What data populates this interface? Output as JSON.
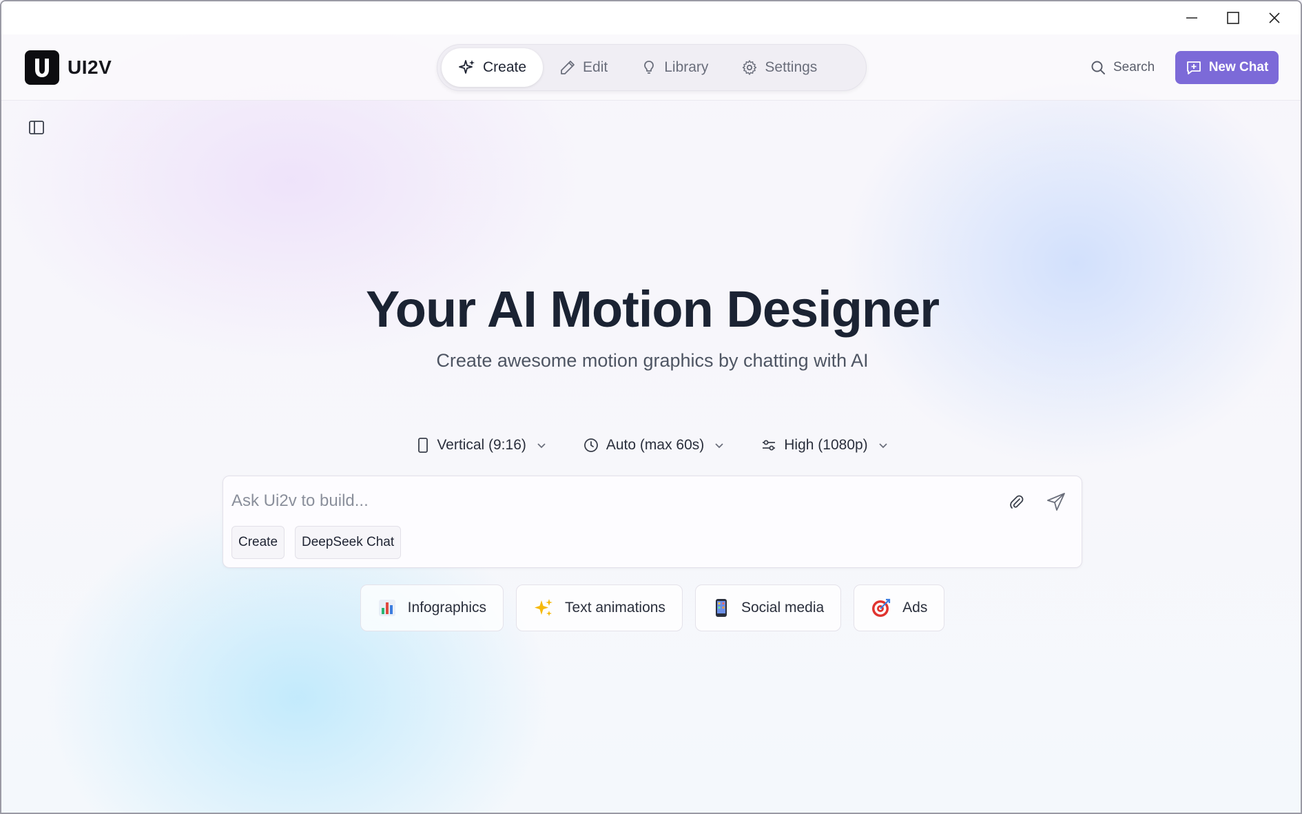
{
  "app": {
    "name": "UI2V",
    "logo_letter": "U"
  },
  "window_controls": {
    "minimize_icon": "minimize-icon",
    "maximize_icon": "maximize-icon",
    "close_icon": "close-icon"
  },
  "nav": {
    "items": [
      {
        "label": "Create",
        "icon": "sparkle-icon",
        "active": true
      },
      {
        "label": "Edit",
        "icon": "pencil-icon",
        "active": false
      },
      {
        "label": "Library",
        "icon": "lightbulb-icon",
        "active": false
      },
      {
        "label": "Settings",
        "icon": "gear-icon",
        "active": false
      }
    ]
  },
  "header": {
    "search_label": "Search",
    "new_chat_label": "New Chat"
  },
  "hero": {
    "title": "Your AI Motion Designer",
    "subtitle": "Create awesome motion graphics by chatting with AI"
  },
  "options": {
    "aspect": "Vertical (9:16)",
    "duration": "Auto (max 60s)",
    "quality": "High (1080p)"
  },
  "composer": {
    "placeholder": "Ask Ui2v to build...",
    "value": "",
    "mode_chip": "Create",
    "model_chip": "DeepSeek Chat"
  },
  "categories": [
    {
      "label": "Infographics",
      "icon": "bar-chart-icon"
    },
    {
      "label": "Text animations",
      "icon": "sparkles-icon"
    },
    {
      "label": "Social media",
      "icon": "phone-icon"
    },
    {
      "label": "Ads",
      "icon": "target-icon"
    }
  ],
  "colors": {
    "accent": "#7c6ad8",
    "title": "#1b2333"
  }
}
